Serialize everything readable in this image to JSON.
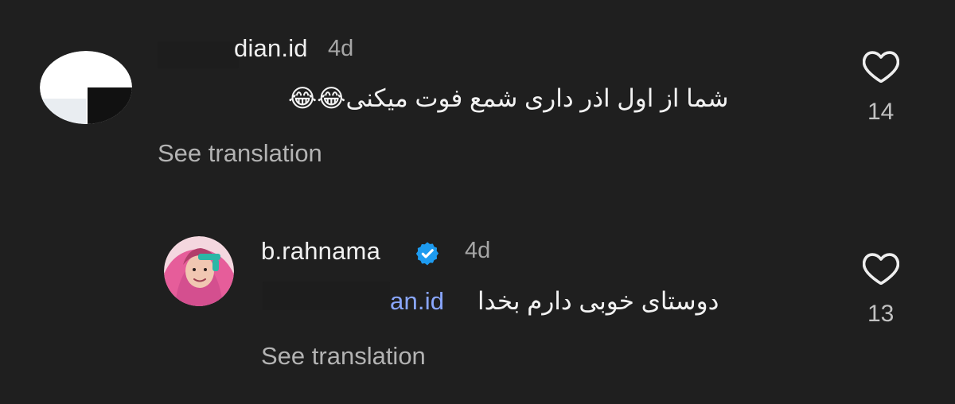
{
  "comments": [
    {
      "username": "dian.id",
      "time": "4d",
      "text": "شما از اول اذر داری شمع فوت میکنی😂😂",
      "translation": "See translation",
      "likes": "14"
    },
    {
      "username": "b.rahnama",
      "time": "4d",
      "mention": "an.id",
      "text": "دوستای خوبی دارم بخدا",
      "translation": "See translation",
      "likes": "13"
    }
  ],
  "icons": {
    "like": "heart-icon",
    "verified": "verified-badge-icon"
  },
  "colors": {
    "background": "#1f1f1f",
    "verified": "#1d9bf0",
    "secondary_text": "#a6a6a6"
  }
}
